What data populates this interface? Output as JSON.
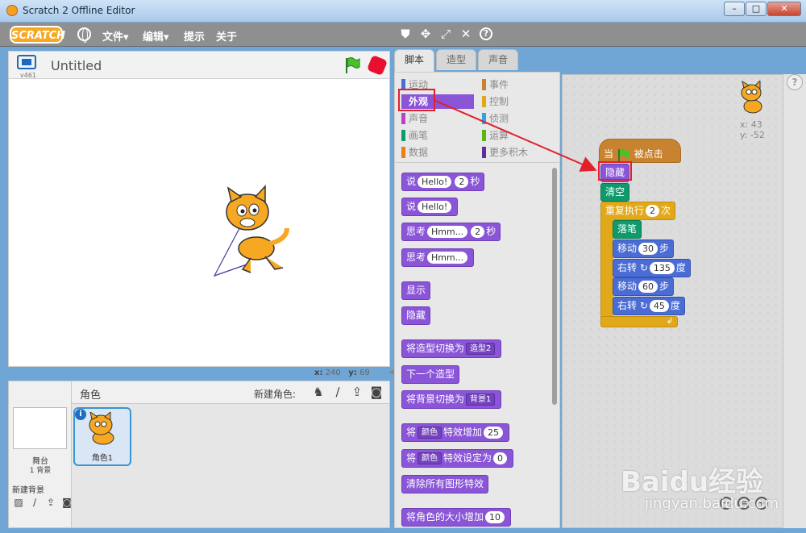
{
  "window": {
    "title": "Scratch 2 Offline Editor",
    "buttons": [
      "–",
      "□",
      "✕"
    ]
  },
  "menubar": {
    "logo": "SCRATCH",
    "items": [
      "文件▾",
      "编辑▾",
      "提示",
      "关于"
    ],
    "tool_icons": [
      "stamp-icon",
      "cut-icon",
      "grow-icon",
      "shrink-icon",
      "help-icon"
    ]
  },
  "stage": {
    "version": "v461",
    "project_title": "Untitled",
    "x_label": "x:",
    "x_value": "240",
    "y_label": "y:",
    "y_value": "69"
  },
  "sprites": {
    "header_label": "角色",
    "new_sprite_label": "新建角色:",
    "stage_label": "舞台",
    "stage_backdrops": "1 背景",
    "new_backdrop_label": "新建背景",
    "sprite_name": "角色1"
  },
  "tabs": [
    "脚本",
    "造型",
    "声音"
  ],
  "categories": [
    {
      "label": "运动",
      "color": "#4a6cd4"
    },
    {
      "label": "外观",
      "color": "#8a55d7"
    },
    {
      "label": "声音",
      "color": "#bb42c3"
    },
    {
      "label": "画笔",
      "color": "#0e9a6c"
    },
    {
      "label": "数据",
      "color": "#ee7d16"
    },
    {
      "label": "事件",
      "color": "#c88330"
    },
    {
      "label": "控制",
      "color": "#e1a91a"
    },
    {
      "label": "侦测",
      "color": "#2ca5e2"
    },
    {
      "label": "运算",
      "color": "#5cb712"
    },
    {
      "label": "更多积木",
      "color": "#632d99"
    }
  ],
  "palette": {
    "say_secs": {
      "a": "说",
      "msg": "Hello!",
      "secs": "2",
      "b": "秒"
    },
    "say": {
      "a": "说",
      "msg": "Hello!"
    },
    "think_secs": {
      "a": "思考",
      "msg": "Hmm...",
      "secs": "2",
      "b": "秒"
    },
    "think": {
      "a": "思考",
      "msg": "Hmm..."
    },
    "show": "显示",
    "hide": "隐藏",
    "switch_costume": {
      "a": "将造型切换为",
      "v": "造型2"
    },
    "next_costume": "下一个造型",
    "switch_backdrop": {
      "a": "将背景切换为",
      "v": "背景1"
    },
    "change_effect": {
      "a": "将",
      "v": "颜色",
      "b": "特效增加",
      "n": "25"
    },
    "set_effect": {
      "a": "将",
      "v": "颜色",
      "b": "特效设定为",
      "n": "0"
    },
    "clear_effects": "清除所有图形特效",
    "change_size": {
      "a": "将角色的大小增加",
      "n": "10"
    }
  },
  "script": {
    "when": "当",
    "clicked": "被点击",
    "hide": "隐藏",
    "clear": "清空",
    "repeat": {
      "a": "重复执行",
      "n": "2",
      "b": "次"
    },
    "pen_down": "落笔",
    "move1": {
      "a": "移动",
      "n": "30",
      "b": "步"
    },
    "turn1": {
      "a": "右转",
      "n": "135",
      "b": "度"
    },
    "move2": {
      "a": "移动",
      "n": "60",
      "b": "步"
    },
    "turn2": {
      "a": "右转",
      "n": "45",
      "b": "度"
    }
  },
  "sprite_info": {
    "x": "x: 43",
    "y": "y: -52"
  },
  "watermark": {
    "main": "Baidu经验",
    "sub": "jingyan.baidu.com"
  }
}
